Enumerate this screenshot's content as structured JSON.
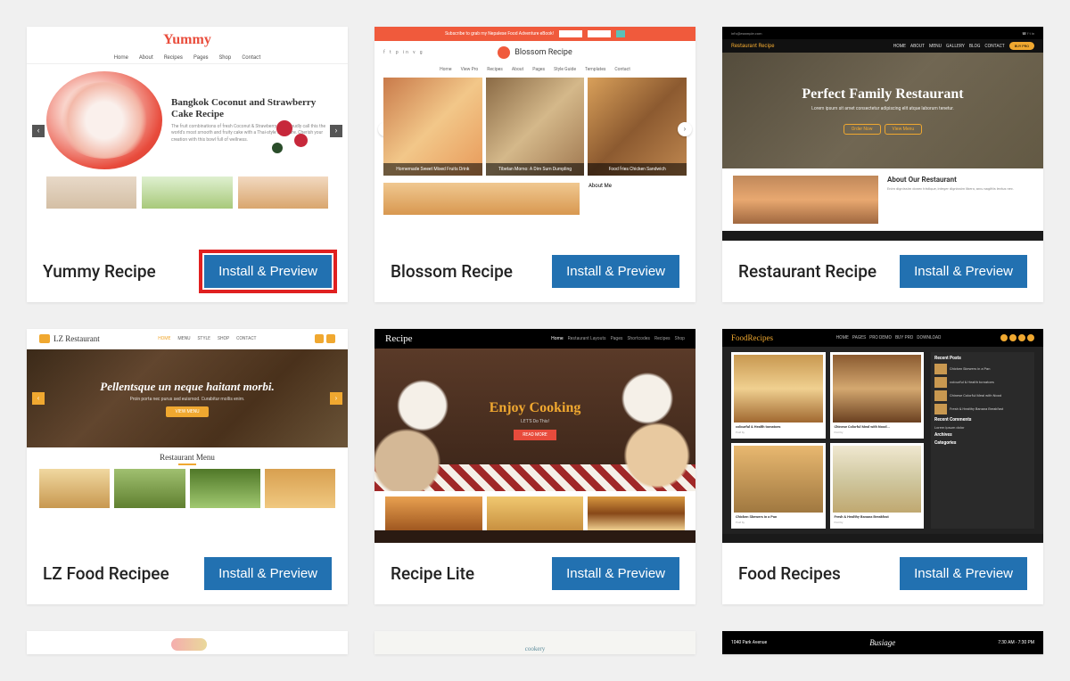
{
  "button_label": "Install & Preview",
  "themes": [
    {
      "name": "Yummy Recipe",
      "highlighted": true,
      "preview": {
        "logo": "Yummy",
        "hero_title": "Bangkok Coconut and Strawberry Cake Recipe",
        "nav": [
          "Home",
          "About",
          "Recipes",
          "Pages",
          "Shop",
          "Contact"
        ]
      }
    },
    {
      "name": "Blossom Recipe",
      "preview": {
        "topbar_text": "Subscribe to grab my Nepalese Food Adventure eBook!",
        "brand": "Blossom Recipe",
        "nav": [
          "Home",
          "View Pro",
          "Recipes",
          "About",
          "Pages",
          "Style Guide",
          "Templates",
          "Contact"
        ],
        "cards": [
          "Homemade Sweet Mixed Fruits Drink",
          "Tibetan Momo: A Dim Sum Dumpling",
          "Food fries Chicken Sandwich"
        ],
        "sidebar_heading": "About Me"
      }
    },
    {
      "name": "Restaurant Recipe",
      "preview": {
        "brand": "Restaurant Recipe",
        "topbar_left": "info@example.com",
        "nav": [
          "HOME",
          "ABOUT",
          "MENU",
          "GALLERY",
          "BLOG",
          "CONTACT"
        ],
        "nav_button": "BUY PRO",
        "hero_title": "Perfect Family Restaurant",
        "hero_sub": "Lorem ipsum sit amet consectetur adipiscing elit atque laborum tenetur.",
        "hero_buttons": [
          "Order Now",
          "View Menu"
        ],
        "about_title": "About Our Restaurant",
        "about_text": "Enim dignissim donec tristique, integer dignissim libero, arcu sagittis lectus nec."
      }
    },
    {
      "name": "LZ Food Recipee",
      "preview": {
        "brand": "LZ Restaurant",
        "nav": [
          "HOME",
          "MENU",
          "STYLE",
          "SHOP",
          "CONTACT"
        ],
        "hero_title": "Pellentsque un neque haitant morbi.",
        "hero_sub": "Proin porta nec purus sed euismod. Curabitur mollis enim.",
        "hero_btn": "VIEW MENU",
        "menu_heading": "Restaurant Menu"
      }
    },
    {
      "name": "Recipe Lite",
      "preview": {
        "brand": "Recipe",
        "nav": [
          "Home",
          "Restaurant Layouts",
          "Pages",
          "Shortcodes",
          "Recipes",
          "Shop"
        ],
        "hero_title_a": "Enjoy",
        "hero_title_b": "Cooking",
        "hero_sub": "LET'S Do This!",
        "hero_btn": "READ MORE"
      }
    },
    {
      "name": "Food Recipes",
      "preview": {
        "brand_a": "Food",
        "brand_b": "Recipes",
        "nav": [
          "HOME",
          "PAGES",
          "PRO DEMO",
          "BUY PRO",
          "DOWNLOAD"
        ],
        "cards": [
          "colourful & Health tomatoes",
          "Chinese Colorful Meal with Nood...",
          "Chicken Skewers in a Pan",
          "Fresh & Healthy Banana Breakfast"
        ],
        "card_meta": "Post by",
        "side_recent_posts": "Recent Posts",
        "side_recent_comments": "Recent Comments",
        "side_archives": "Archives",
        "side_categories": "Categories",
        "side_items": [
          "Chicken Skewers in a Pan",
          "colourful & Health tomatoes",
          "Chinese Colorful Meal with Nood",
          "Fresh & Healthy Banana Breakfast"
        ]
      }
    }
  ],
  "partial": [
    {
      "brand": ""
    },
    {
      "brand": "cookery"
    },
    {
      "brand": "Busiage",
      "left": "1040 Park Avenue",
      "right": "7:30 AM - 7:30 PM"
    }
  ]
}
